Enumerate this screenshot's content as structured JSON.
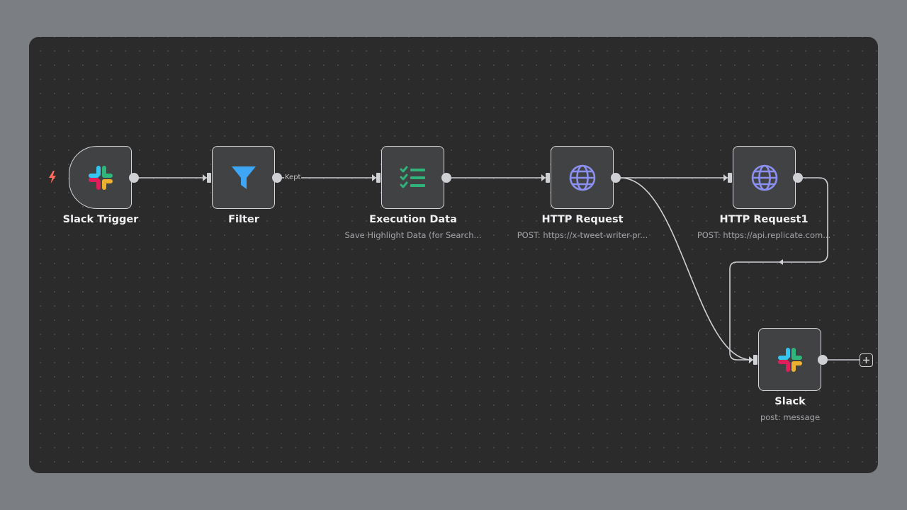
{
  "workflow": {
    "nodes": [
      {
        "id": "slack-trigger",
        "title": "Slack Trigger",
        "subtitle": "",
        "icon": "slack-icon"
      },
      {
        "id": "filter",
        "title": "Filter",
        "subtitle": "",
        "icon": "filter-funnel-icon"
      },
      {
        "id": "execution-data",
        "title": "Execution Data",
        "subtitle": "Save Highlight Data (for Search...",
        "icon": "checklist-icon"
      },
      {
        "id": "http-request",
        "title": "HTTP Request",
        "subtitle": "POST: https://x-tweet-writer-pr...",
        "icon": "globe-icon"
      },
      {
        "id": "http-request1",
        "title": "HTTP Request1",
        "subtitle": "POST: https://api.replicate.com...",
        "icon": "globe-icon"
      },
      {
        "id": "slack",
        "title": "Slack",
        "subtitle": "post: message",
        "icon": "slack-icon"
      }
    ],
    "edge_labels": {
      "filter_kept": "Kept"
    }
  },
  "colors": {
    "filter_icon": "#3ea6f5",
    "checklist_icon": "#2fb37b",
    "globe_icon": "#8b8ff0",
    "trigger_bolt": "#ff6d5a"
  }
}
